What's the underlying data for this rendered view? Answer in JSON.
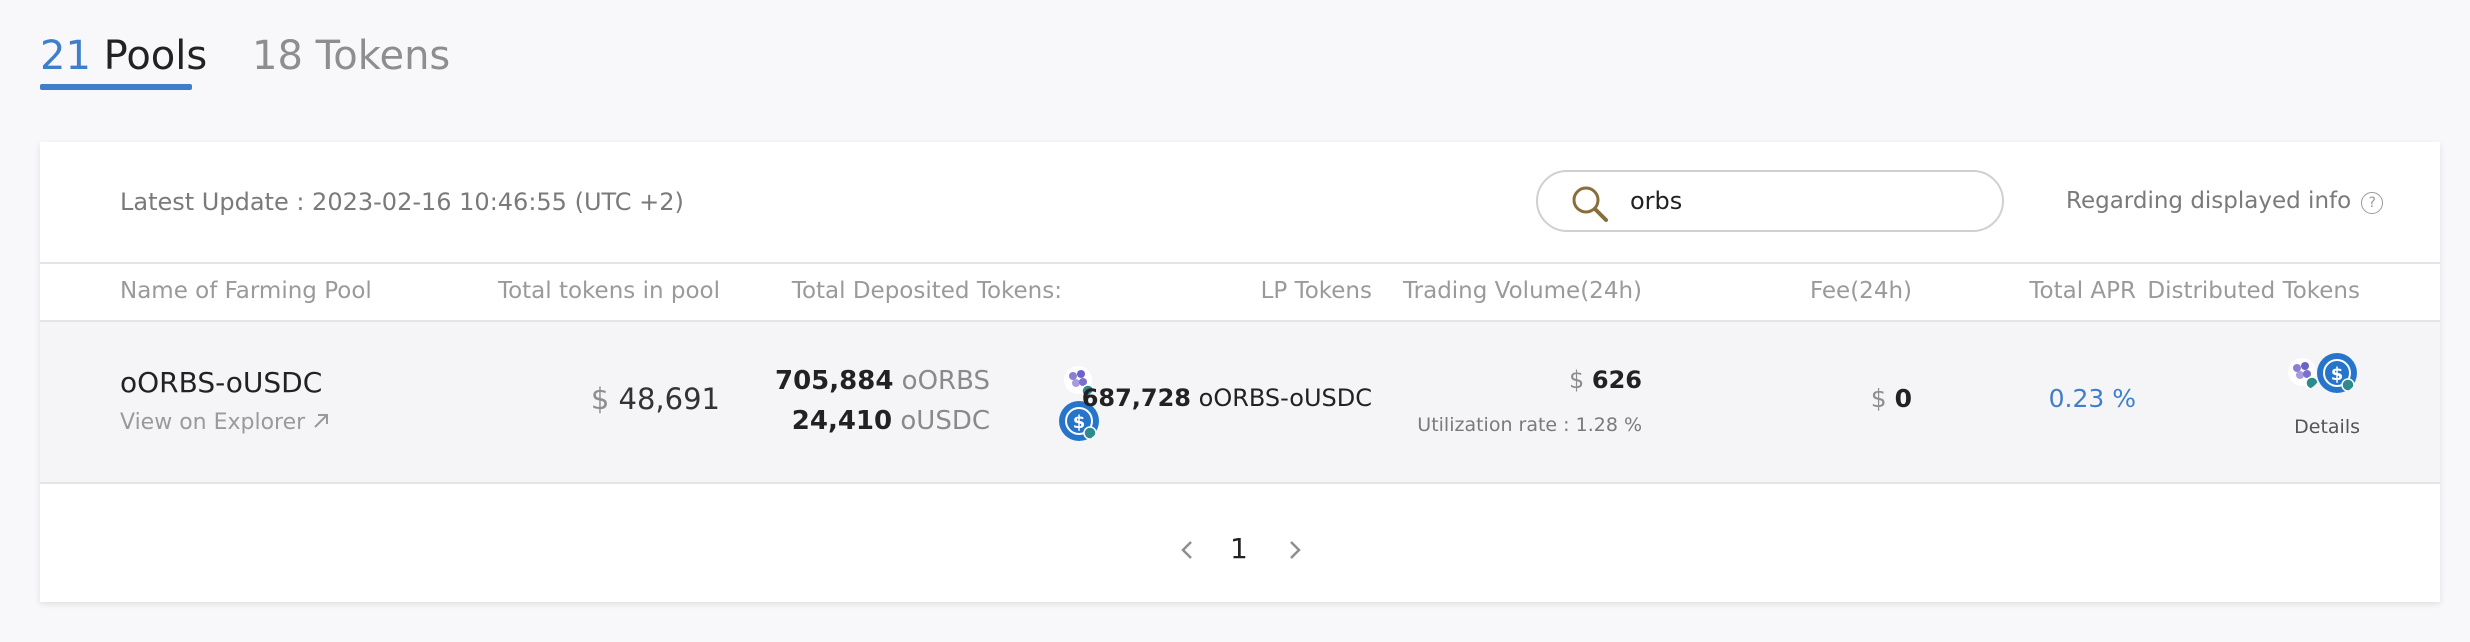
{
  "tabs": {
    "pools": {
      "count": "21",
      "label": "Pools"
    },
    "tokens": {
      "count": "18",
      "label": "Tokens"
    }
  },
  "toolbar": {
    "latest_update": "Latest Update : 2023-02-16  10:46:55 (UTC +2)",
    "search_value": "orbs",
    "info_label": "Regarding displayed info",
    "info_icon": "question-icon"
  },
  "table": {
    "columns": [
      "Name of Farming Pool",
      "Total tokens in pool",
      "Total Deposited Tokens:",
      "LP Tokens",
      "Trading Volume(24h)",
      "Fee(24h)",
      "Total APR",
      "Distributed Tokens"
    ],
    "rows": [
      {
        "name": "oORBS-oUSDC",
        "explorer": "View on Explorer",
        "explorer_icon": "external-arrow-icon",
        "total_currency": "$",
        "total_tokens": "48,691",
        "deposits": [
          {
            "amount": "705,884",
            "symbol": "oORBS",
            "icon": "orbs-token-icon"
          },
          {
            "amount": "24,410",
            "symbol": "oUSDC",
            "icon": "usdc-token-icon"
          }
        ],
        "lp_amount": "687,728",
        "lp_symbol": "oORBS-oUSDC",
        "volume_currency": "$",
        "volume": "626",
        "utilization": "Utilization rate : 1.28 %",
        "fee_currency": "$",
        "fee": "0",
        "apr": "0.23 %",
        "details": "Details"
      }
    ]
  },
  "pagination": {
    "current": "1"
  },
  "colors": {
    "accent": "#3f7ecb",
    "usdc": "#2775ca",
    "orbs": "#8a7fd6"
  }
}
